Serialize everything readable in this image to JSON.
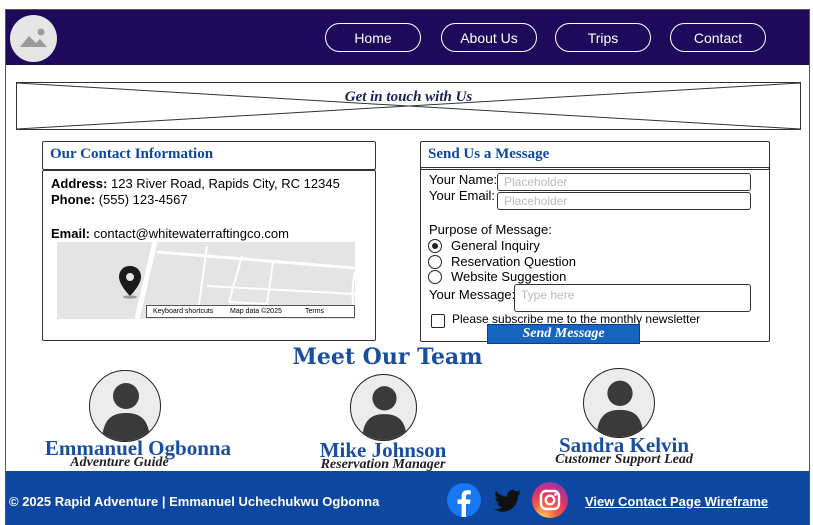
{
  "nav": {
    "items": [
      {
        "label": "Home"
      },
      {
        "label": "About Us"
      },
      {
        "label": "Trips"
      },
      {
        "label": "Contact"
      }
    ],
    "logo_icon": "image-placeholder-icon"
  },
  "banner": {
    "title": "Get in touch with Us"
  },
  "contact": {
    "heading": "Our Contact Information",
    "address_label": "Address:",
    "address": "123 River Road, Rapids City, RC 12345",
    "phone_label": "Phone:",
    "phone": "(555) 123-4567",
    "email_label": "Email:",
    "email": "contact@whitewaterraftingco.com",
    "map": {
      "attribution": {
        "shortcuts": "Keyboard shortcuts",
        "data": "Map data ©2025",
        "terms": "Terms"
      },
      "pin_icon": "map-pin-icon"
    }
  },
  "message": {
    "heading": "Send Us a Message",
    "name_label": "Your Name:",
    "name_placeholder": "Placeholder",
    "email_label": "Your Email:",
    "email_placeholder": "Placeholder",
    "purpose_label": "Purpose of Message:",
    "options": [
      {
        "label": "General Inquiry",
        "selected": true
      },
      {
        "label": "Reservation Question",
        "selected": false
      },
      {
        "label": "Website Suggestion",
        "selected": false
      }
    ],
    "message_label": "Your Message:",
    "message_placeholder": "Type here",
    "newsletter_label": "Please subscribe me to the monthly newsletter",
    "newsletter_checked": false,
    "send_label": "Send Message"
  },
  "team": {
    "title": "Meet Our Team",
    "members": [
      {
        "name": "Emmanuel Ogbonna",
        "role": "Adventure Guide"
      },
      {
        "name": "Mike Johnson",
        "role": "Reservation Manager"
      },
      {
        "name": "Sandra Kelvin",
        "role": "Customer Support Lead"
      }
    ]
  },
  "footer": {
    "copyright": "© 2025 Rapid Adventure | Emmanuel Uchechukwu Ogbonna",
    "link": "View Contact Page Wireframe",
    "social": [
      "facebook-icon",
      "twitter-icon",
      "instagram-icon"
    ]
  },
  "colors": {
    "header_bg": "#1e0a5a",
    "accent_blue": "#0d47a1",
    "footer_bg": "#0d47a1",
    "button_blue": "#1565c0"
  }
}
